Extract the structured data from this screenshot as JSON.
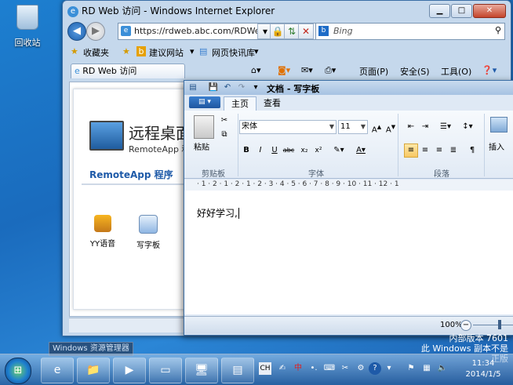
{
  "desktop": {
    "recycle_label": "回收站"
  },
  "ie": {
    "title": "RD Web 访问 - Windows Internet Explorer",
    "address": "https://rdweb.abc.com/RDWeb,",
    "search_placeholder": "Bing",
    "favorites_label": "收藏夹",
    "suggested_sites": "建议网站",
    "web_slice": "网页快讯库",
    "tab_title": "RD Web 访问",
    "cmd_page": "页面(P)",
    "cmd_safety": "安全(S)",
    "cmd_tools": "工具(O)"
  },
  "rdweb": {
    "title": "远程桌面",
    "subtitle": "RemoteApp 和",
    "tab": "RemoteApp 程序",
    "apps": [
      "YY语音",
      "写字板"
    ]
  },
  "wordpad": {
    "title": "文档 - 写字板",
    "tabs": [
      "主页",
      "查看"
    ],
    "paste": "粘贴",
    "font_name": "宋体",
    "font_size": "11",
    "groups": [
      "剪贴板",
      "字体",
      "段落"
    ],
    "insert": "插入",
    "ruler": "· 1 · 2 · 1 · 2 · 1 · 2 · 3 · 4 · 5 · 6 · 7 · 8 · 9 · 10 · 11 · 12 · 1",
    "doc_text": "好好学习,",
    "zoom": "100%"
  },
  "taskbar": {
    "tooltip": "Windows 资源管理器",
    "tray_lang": "CH",
    "tray_ime": "中",
    "time": "11:34",
    "date": "2014/1/5"
  },
  "notice": {
    "line1": "内部版本 7601",
    "line2": "此 Windows 副本不是正版"
  }
}
